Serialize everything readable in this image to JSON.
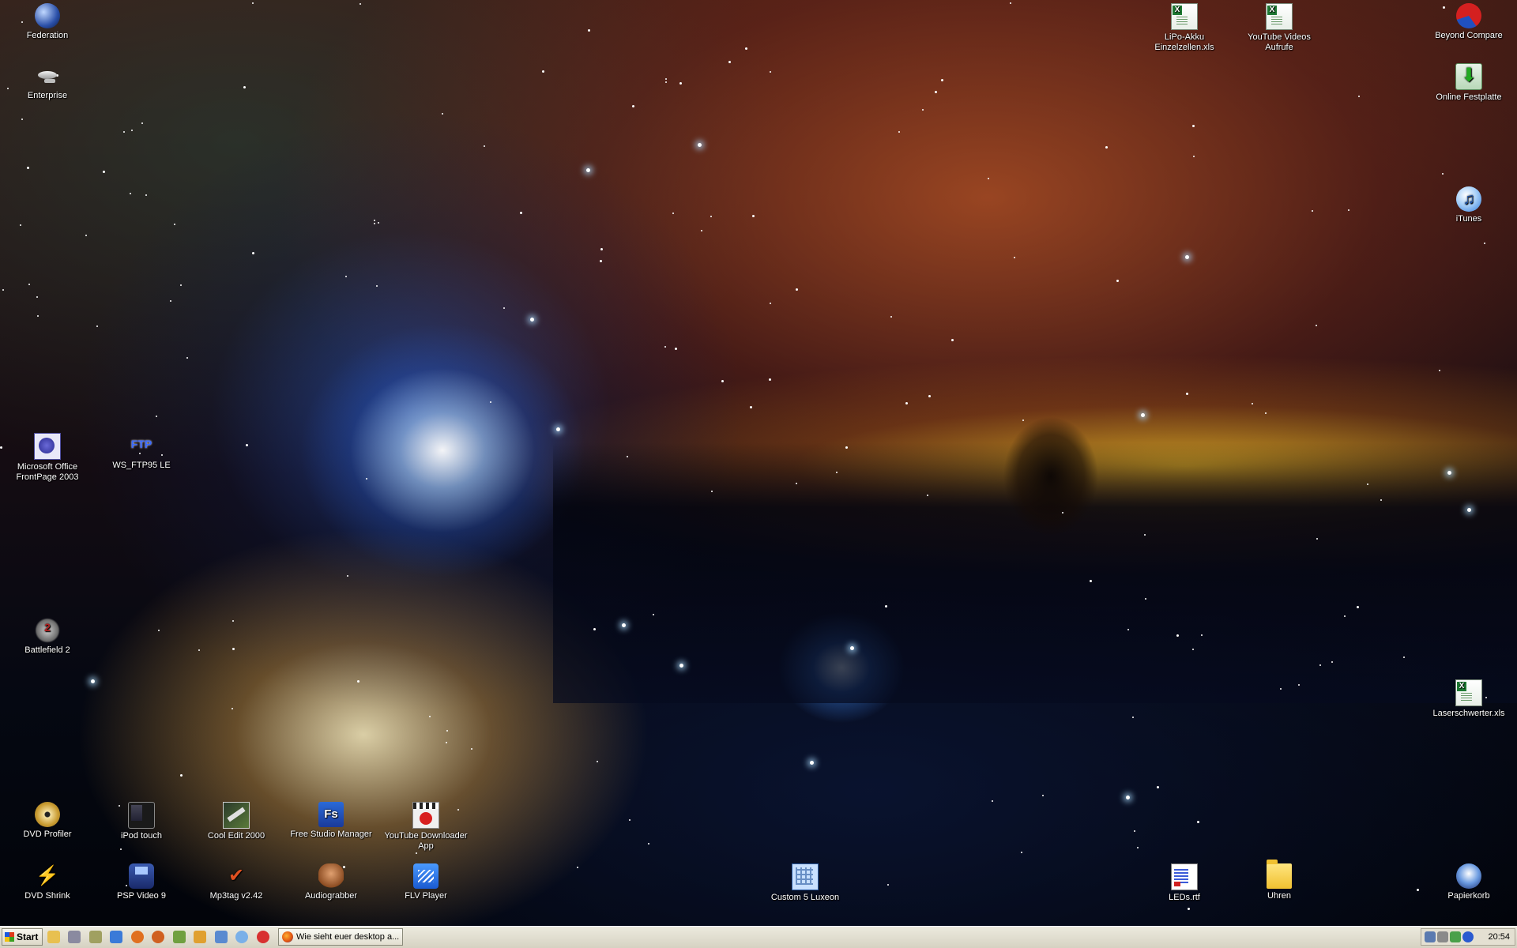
{
  "desktop": {
    "icons": [
      {
        "label": "Federation",
        "icon": "federation-icon"
      },
      {
        "label": "Enterprise",
        "icon": "enterprise-icon"
      },
      {
        "label": "Microsoft Office FrontPage 2003",
        "icon": "frontpage-icon"
      },
      {
        "label": "WS_FTP95 LE",
        "icon": "ftp-icon"
      },
      {
        "label": "Battlefield 2",
        "icon": "battlefield-icon"
      },
      {
        "label": "DVD Profiler",
        "icon": "dvd-icon"
      },
      {
        "label": "iPod touch",
        "icon": "ipod-icon"
      },
      {
        "label": "Cool Edit 2000",
        "icon": "cooledit-icon"
      },
      {
        "label": "Free Studio Manager",
        "icon": "freestudio-icon"
      },
      {
        "label": "YouTube Downloader App",
        "icon": "youtube-downloader-icon"
      },
      {
        "label": "DVD Shrink",
        "icon": "dvdshrink-icon"
      },
      {
        "label": "PSP Video 9",
        "icon": "psp-icon"
      },
      {
        "label": "Mp3tag v2.42",
        "icon": "mp3tag-icon"
      },
      {
        "label": "Audiograbber",
        "icon": "audiograbber-icon"
      },
      {
        "label": "FLV Player",
        "icon": "flv-player-icon"
      },
      {
        "label": "Custom 5 Luxeon",
        "icon": "custom-luxeon-icon"
      },
      {
        "label": "LiPo-Akku Einzelzellen.xls",
        "icon": "excel-file-icon"
      },
      {
        "label": "YouTube Videos Aufrufe",
        "icon": "excel-file-icon"
      },
      {
        "label": "Beyond Compare",
        "icon": "beyond-compare-icon"
      },
      {
        "label": "Online Festplatte",
        "icon": "online-drive-icon"
      },
      {
        "label": "iTunes",
        "icon": "itunes-icon"
      },
      {
        "label": "Laserschwerter.xls",
        "icon": "excel-file-icon"
      },
      {
        "label": "LEDs.rtf",
        "icon": "rtf-file-icon"
      },
      {
        "label": "Uhren",
        "icon": "folder-icon"
      },
      {
        "label": "Papierkorb",
        "icon": "recycle-bin-icon"
      }
    ]
  },
  "taskbar": {
    "start_label": "Start",
    "quicklaunch": [
      "explorer-icon",
      "show-desktop-icon",
      "network-icon",
      "ie-icon",
      "firefox-icon",
      "firefox2-icon",
      "edit-icon",
      "search-icon",
      "screen-icon",
      "itunes-small-icon",
      "app-icon"
    ],
    "tasks": [
      {
        "label": "Wie sieht euer desktop a...",
        "icon": "firefox-icon"
      }
    ],
    "clock": "20:54"
  }
}
